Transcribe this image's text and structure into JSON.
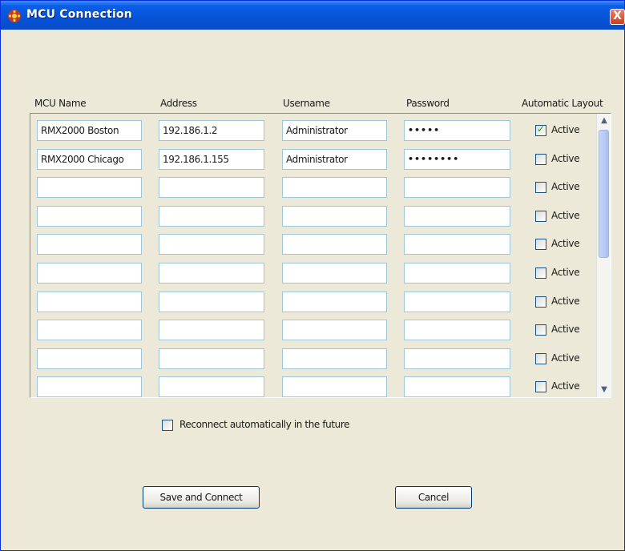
{
  "window": {
    "title": "MCU Connection",
    "close_glyph": "X"
  },
  "columns": {
    "name": "MCU Name",
    "address": "Address",
    "username": "Username",
    "password": "Password",
    "layout": "Automatic Layout"
  },
  "rows": [
    {
      "name": "RMX2000 Boston",
      "address": "192.186.1.2",
      "username": "Administrator",
      "password": "•••••",
      "active_label": "Active",
      "checked": true
    },
    {
      "name": "RMX2000 Chicago",
      "address": "192.186.1.155",
      "username": "Administrator",
      "password": "••••••••",
      "active_label": "Active",
      "checked": false
    },
    {
      "name": "",
      "address": "",
      "username": "",
      "password": "",
      "active_label": "Active",
      "checked": false
    },
    {
      "name": "",
      "address": "",
      "username": "",
      "password": "",
      "active_label": "Active",
      "checked": false
    },
    {
      "name": "",
      "address": "",
      "username": "",
      "password": "",
      "active_label": "Active",
      "checked": false
    },
    {
      "name": "",
      "address": "",
      "username": "",
      "password": "",
      "active_label": "Active",
      "checked": false
    },
    {
      "name": "",
      "address": "",
      "username": "",
      "password": "",
      "active_label": "Active",
      "checked": false
    },
    {
      "name": "",
      "address": "",
      "username": "",
      "password": "",
      "active_label": "Active",
      "checked": false
    },
    {
      "name": "",
      "address": "",
      "username": "",
      "password": "",
      "active_label": "Active",
      "checked": false
    },
    {
      "name": "",
      "address": "",
      "username": "",
      "password": "",
      "active_label": "Active",
      "checked": false
    }
  ],
  "reconnect": {
    "label": "Reconnect automatically in the future",
    "checked": false
  },
  "buttons": {
    "save": "Save and Connect",
    "cancel": "Cancel"
  },
  "scrollbar": {
    "up_glyph": "▲",
    "down_glyph": "▼"
  },
  "colors": {
    "titlebar": "#0553d6",
    "dialog_bg": "#ece9d8",
    "field_border": "#9ec6d8",
    "check_tick": "#21a121"
  }
}
